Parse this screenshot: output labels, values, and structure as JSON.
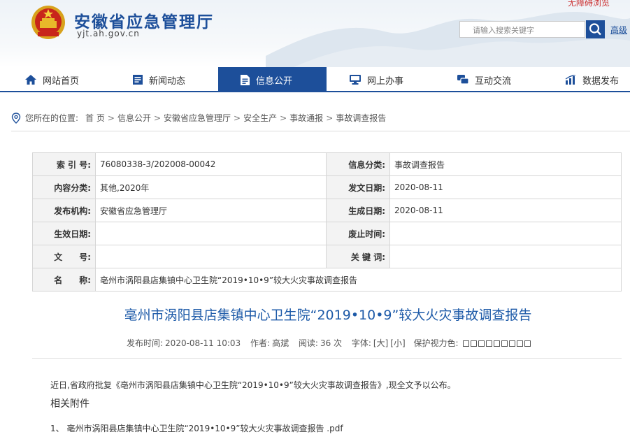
{
  "header": {
    "site_title": "安徽省应急管理厅",
    "domain": "yjt.ah.gov.cn",
    "top_link": "无障碍浏览",
    "search_placeholder": "请输入搜索关键字",
    "advanced_search": "高级"
  },
  "nav": {
    "items": [
      {
        "label": "网站首页",
        "icon": "home-icon"
      },
      {
        "label": "新闻动态",
        "icon": "news-icon"
      },
      {
        "label": "信息公开",
        "icon": "document-icon",
        "active": true
      },
      {
        "label": "网上办事",
        "icon": "monitor-icon"
      },
      {
        "label": "互动交流",
        "icon": "chat-icon"
      },
      {
        "label": "数据发布",
        "icon": "chart-icon"
      }
    ]
  },
  "breadcrumb": {
    "prefix": "您所在的位置:",
    "items": [
      "首 页",
      "信息公开",
      "安徽省应急管理厅",
      "安全生产",
      "事故通报",
      "事故调查报告"
    ]
  },
  "meta": {
    "rows": [
      {
        "l1": "索 引 号:",
        "v1": "76080338-3/202008-00042",
        "l2": "信息分类:",
        "v2": "事故调查报告"
      },
      {
        "l1": "内容分类:",
        "v1": "其他,2020年",
        "l2": "发文日期:",
        "v2": "2020-08-11"
      },
      {
        "l1": "发布机构:",
        "v1": "安徽省应急管理厅",
        "l2": "生成日期:",
        "v2": "2020-08-11"
      },
      {
        "l1": "生效日期:",
        "v1": "",
        "l2": "废止时间:",
        "v2": ""
      },
      {
        "l1": "文　　号:",
        "v1": "",
        "l2": "关 键 词:",
        "v2": ""
      }
    ],
    "name_label": "名　　称:",
    "name_value": "亳州市涡阳县店集镇中心卫生院“2019•10•9”较大火灾事故调查报告"
  },
  "article": {
    "title": "亳州市涡阳县店集镇中心卫生院“2019•10•9”较大火灾事故调查报告",
    "publish_time_label": "发布时间:",
    "publish_time": "2020-08-11 10:03",
    "author_label": "作者:",
    "author": "高斌",
    "reads_label": "阅读:",
    "reads": "36 次",
    "font_label": "字体:",
    "font_large": "[大]",
    "font_small": "[小]",
    "eye_label": "保护视力色:",
    "body": "近日,省政府批复《亳州市涡阳县店集镇中心卫生院“2019•10•9”较大火灾事故调查报告》,现全文予以公布。",
    "attachments_title": "相关附件",
    "attachment": "1、 亳州市涡阳县店集镇中心卫生院“2019•10•9”较大火灾事故调查报告 .pdf"
  },
  "colors": {
    "brand": "#1d4f9a",
    "title_blue": "#1d5aa8"
  }
}
